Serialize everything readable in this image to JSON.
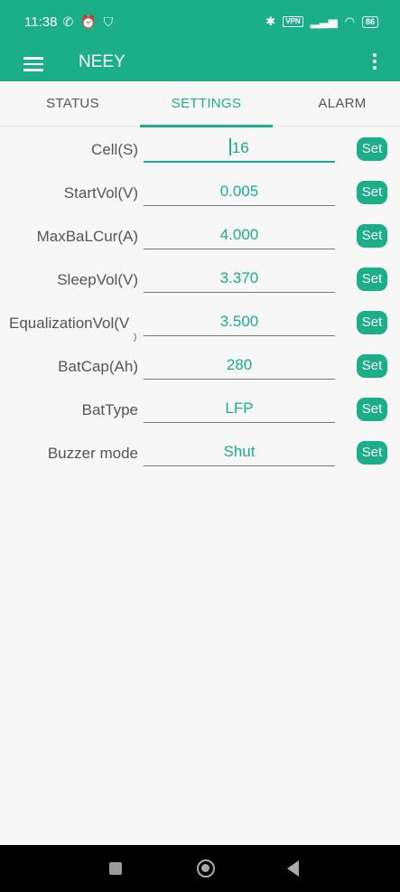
{
  "status_bar": {
    "time": "11:38",
    "icons_left": [
      "nfc-icon",
      "alarm-icon",
      "shield-icon"
    ],
    "icons_right": [
      "bluetooth-icon",
      "vpn-icon",
      "signal-icon",
      "wifi-icon",
      "battery-icon"
    ],
    "vpn_label": "VPN",
    "battery_level": "86"
  },
  "app_bar": {
    "title": "NEEY"
  },
  "tabs": [
    {
      "label": "STATUS",
      "active": false
    },
    {
      "label": "SETTINGS",
      "active": true
    },
    {
      "label": "ALARM",
      "active": false
    }
  ],
  "settings": [
    {
      "label": "Cell(S)",
      "value": "16",
      "button": "Set"
    },
    {
      "label": "StartVol(V)",
      "value": "0.005",
      "button": "Set"
    },
    {
      "label": "MaxBaLCur(A)",
      "value": "4.000",
      "button": "Set"
    },
    {
      "label": "SleepVol(V)",
      "value": "3.370",
      "button": "Set"
    },
    {
      "label": "EqualizationVol(V",
      "label_wrap": ")",
      "value": "3.500",
      "button": "Set"
    },
    {
      "label": "BatCap(Ah)",
      "value": "280",
      "button": "Set"
    },
    {
      "label": "BatType",
      "value": "LFP",
      "button": "Set"
    },
    {
      "label": "Buzzer mode",
      "value": "Shut",
      "button": "Set"
    }
  ],
  "colors": {
    "primary": "#1aaf86",
    "background": "#f7f7f7",
    "text": "#555555",
    "nav_bar": "#000000"
  }
}
